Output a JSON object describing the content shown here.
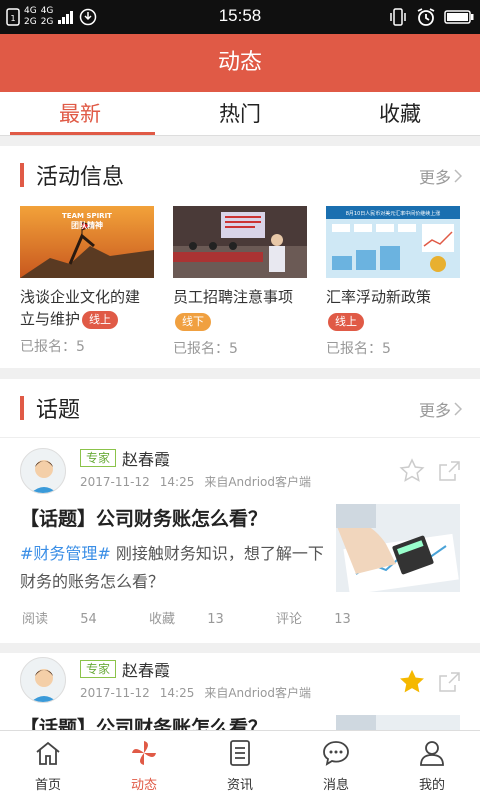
{
  "status": {
    "time": "15:58",
    "net1": "4G",
    "net2": "4G",
    "net3": "2G",
    "net4": "2G"
  },
  "header": {
    "title": "动态"
  },
  "tabs": [
    {
      "label": "最新"
    },
    {
      "label": "热门"
    },
    {
      "label": "收藏"
    }
  ],
  "activities": {
    "title": "活动信息",
    "more": "更多",
    "items": [
      {
        "name": "浅谈企业文化的建立与维护",
        "tag": "线上",
        "count": "已报名：5",
        "thumb_text1": "TEAM SPIRIT",
        "thumb_text2": "团队精神"
      },
      {
        "name": "员工招聘注意事项",
        "tag": "线下",
        "count": "已报名：5"
      },
      {
        "name": "汇率浮动新政策",
        "tag": "线上",
        "count": "已报名：5",
        "thumb_text1": "8月10日人民币对美元汇率中间价继续上涨"
      }
    ]
  },
  "topics": {
    "title": "话题",
    "more": "更多",
    "posts": [
      {
        "badge": "专家",
        "author": "赵春霞",
        "date": "2017-11-12",
        "time": "14:25",
        "source": "来自Andriod客户端",
        "title": "【话题】公司财务账怎么看？",
        "hashtag": "#财务管理#",
        "body": " 刚接触财务知识，想了解一下财务的账务怎么看？",
        "read_label": "阅读",
        "read_count": "54",
        "fav_label": "收藏",
        "fav_count": "13",
        "comment_label": "评论",
        "comment_count": "13",
        "starred": false
      },
      {
        "badge": "专家",
        "author": "赵春霞",
        "date": "2017-11-12",
        "time": "14:25",
        "source": "来自Andriod客户端",
        "title": "【话题】公司财务账怎么看？",
        "starred": true
      }
    ]
  },
  "nav": [
    {
      "label": "首页",
      "icon": "home-icon"
    },
    {
      "label": "动态",
      "icon": "pinwheel-icon"
    },
    {
      "label": "资讯",
      "icon": "document-icon"
    },
    {
      "label": "消息",
      "icon": "chat-icon"
    },
    {
      "label": "我的",
      "icon": "user-icon"
    }
  ],
  "colors": {
    "accent": "#e05a46",
    "online_tag": "#e05a46",
    "offline_tag": "#f0a040",
    "expert": "#6aab3a",
    "hashtag": "#3a8ee6",
    "star_filled": "#f5b800"
  }
}
